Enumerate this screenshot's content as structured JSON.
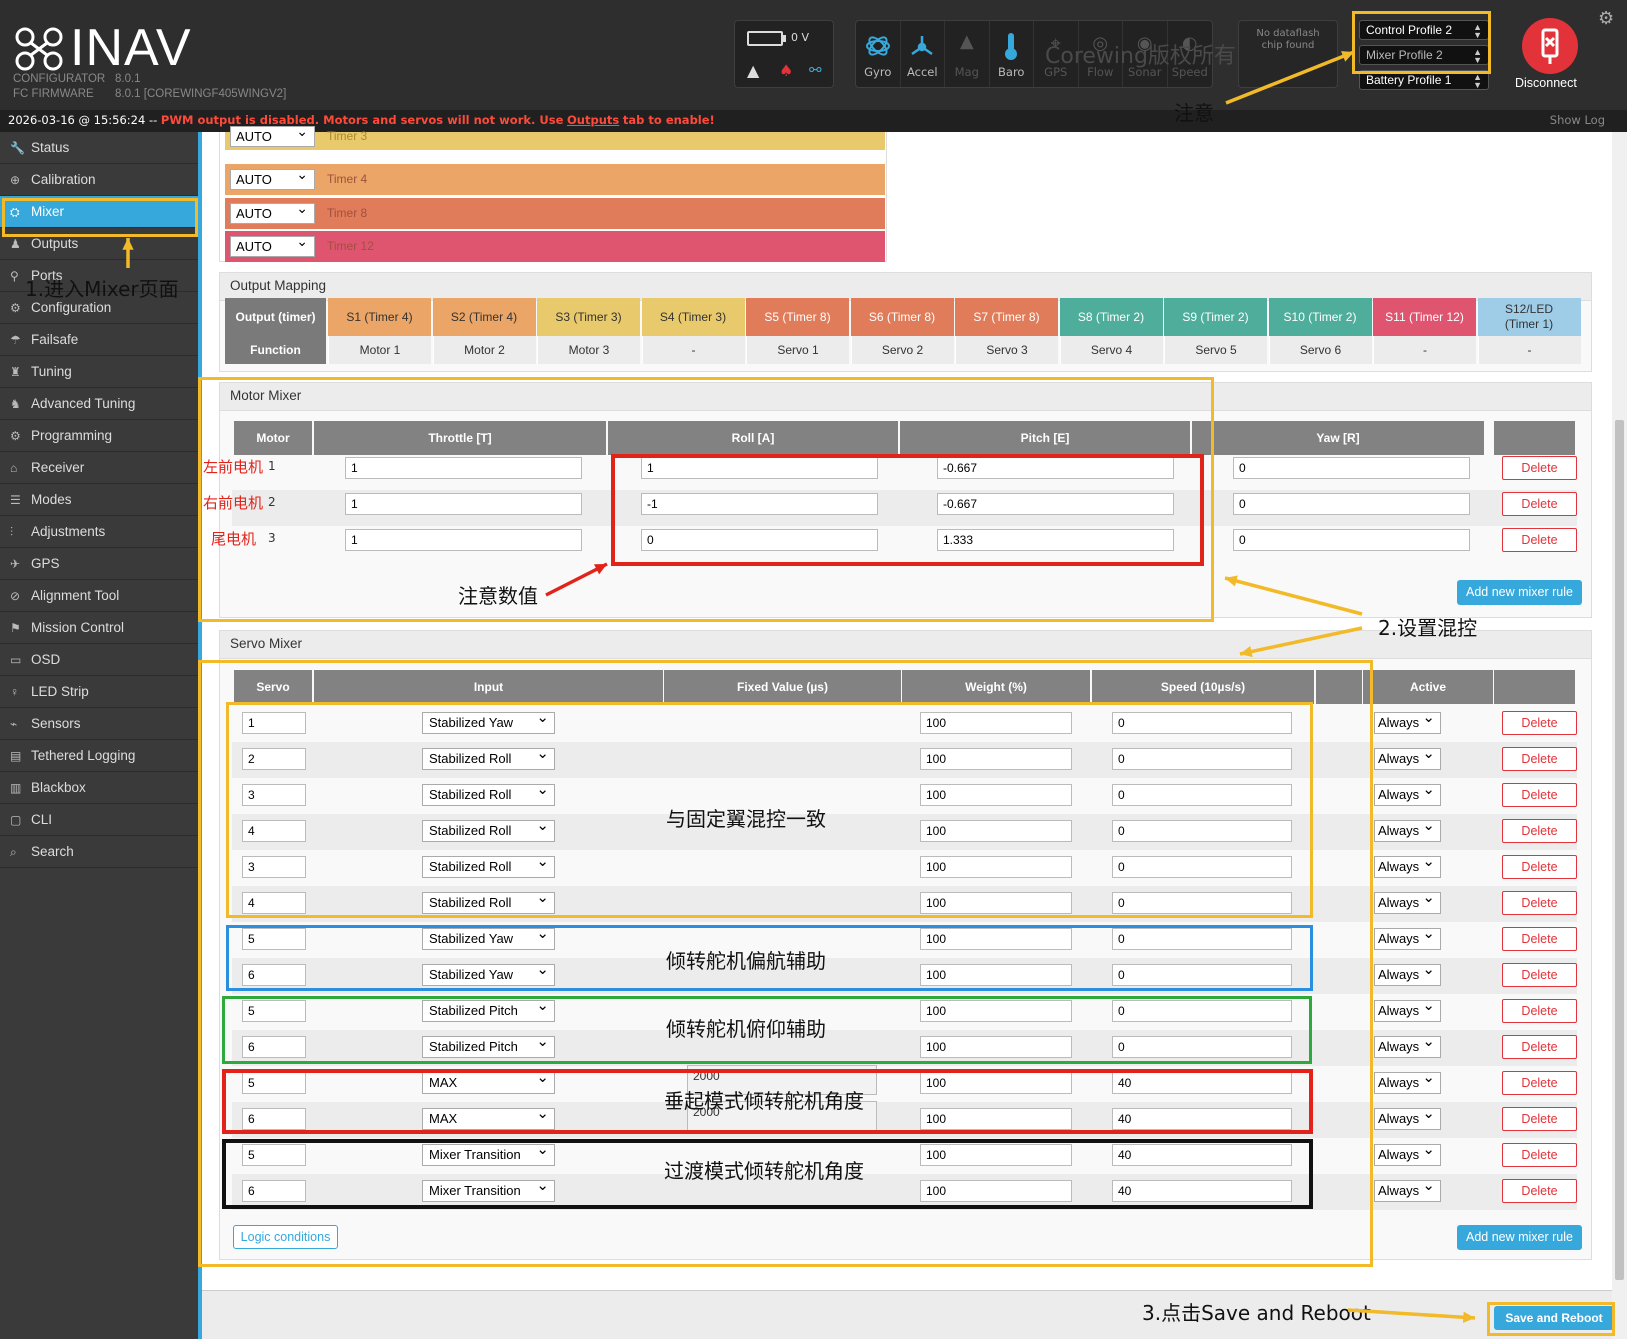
{
  "app": {
    "name": "INAV",
    "configurator_label": "CONFIGURATOR",
    "configurator_version": "8.0.1",
    "firmware_label": "FC FIRMWARE",
    "firmware_version": "8.0.1 [COREWINGF405WINGV2]"
  },
  "battery": {
    "voltage": "0 V"
  },
  "sensors": [
    {
      "label": "Gyro",
      "icon": "gyro-icon",
      "active": true
    },
    {
      "label": "Accel",
      "icon": "accel-icon",
      "active": true
    },
    {
      "label": "Mag",
      "icon": "mag-icon",
      "active": false
    },
    {
      "label": "Baro",
      "icon": "baro-icon",
      "active": true
    },
    {
      "label": "GPS",
      "icon": "gps-icon",
      "active": false
    },
    {
      "label": "Flow",
      "icon": "flow-icon",
      "active": false
    },
    {
      "label": "Sonar",
      "icon": "sonar-icon",
      "active": false
    },
    {
      "label": "Speed",
      "icon": "speed-icon",
      "active": false
    }
  ],
  "dataflash": {
    "line1": "No dataflash",
    "line2": "chip found"
  },
  "profiles": {
    "control": "Control Profile 2",
    "mixer": "Mixer Profile 2",
    "battery": "Battery Profile 1"
  },
  "disconnect_label": "Disconnect",
  "watermark": "Corewing版权所有",
  "statusbar": {
    "timestamp": "2026-03-16 @ 15:56:24 --",
    "warning_pre": "PWM output is disabled. Motors and servos will not work. Use",
    "warning_link": "Outputs",
    "warning_post": "tab to enable!",
    "show_log": "Show Log"
  },
  "sidebar": [
    {
      "label": "Status",
      "icon": "wrench-icon",
      "active": false
    },
    {
      "label": "Calibration",
      "icon": "crosshair-icon",
      "active": false
    },
    {
      "label": "Mixer",
      "icon": "mixer-icon",
      "active": true
    },
    {
      "label": "Outputs",
      "icon": "motor-icon",
      "active": false
    },
    {
      "label": "Ports",
      "icon": "plug-icon",
      "active": false
    },
    {
      "label": "Configuration",
      "icon": "gear-icon",
      "active": false
    },
    {
      "label": "Failsafe",
      "icon": "failsafe-icon",
      "active": false
    },
    {
      "label": "Tuning",
      "icon": "tuning-icon",
      "active": false
    },
    {
      "label": "Advanced Tuning",
      "icon": "advanced-tuning-icon",
      "active": false
    },
    {
      "label": "Programming",
      "icon": "gear-icon",
      "active": false
    },
    {
      "label": "Receiver",
      "icon": "receiver-icon",
      "active": false
    },
    {
      "label": "Modes",
      "icon": "modes-icon",
      "active": false
    },
    {
      "label": "Adjustments",
      "icon": "sliders-icon",
      "active": false
    },
    {
      "label": "GPS",
      "icon": "satellite-icon",
      "active": false
    },
    {
      "label": "Alignment Tool",
      "icon": "compass-icon",
      "active": false
    },
    {
      "label": "Mission Control",
      "icon": "map-pin-icon",
      "active": false
    },
    {
      "label": "OSD",
      "icon": "osd-icon",
      "active": false
    },
    {
      "label": "LED Strip",
      "icon": "led-icon",
      "active": false
    },
    {
      "label": "Sensors",
      "icon": "sensors-icon",
      "active": false
    },
    {
      "label": "Tethered Logging",
      "icon": "logging-icon",
      "active": false
    },
    {
      "label": "Blackbox",
      "icon": "blackbox-icon",
      "active": false
    },
    {
      "label": "CLI",
      "icon": "terminal-icon",
      "active": false
    },
    {
      "label": "Search",
      "icon": "search-icon",
      "active": false
    }
  ],
  "timers": [
    {
      "mode": "AUTO",
      "label": "Timer 3",
      "color": "#e8c96b"
    },
    {
      "mode": "AUTO",
      "label": "Timer 4",
      "color": "#eba566"
    },
    {
      "mode": "AUTO",
      "label": "Timer 8",
      "color": "#e07c5a"
    },
    {
      "mode": "AUTO",
      "label": "Timer 12",
      "color": "#df5570"
    }
  ],
  "output_mapping": {
    "title": "Output Mapping",
    "header_label": "Output (timer)",
    "function_label": "Function",
    "columns": [
      {
        "output": "S1 (Timer 4)",
        "function": "Motor 1",
        "color": "#eba566"
      },
      {
        "output": "S2 (Timer 4)",
        "function": "Motor 2",
        "color": "#eba566"
      },
      {
        "output": "S3 (Timer 3)",
        "function": "Motor 3",
        "color": "#e8c96b"
      },
      {
        "output": "S4 (Timer 3)",
        "function": "-",
        "color": "#e8c96b"
      },
      {
        "output": "S5 (Timer 8)",
        "function": "Servo 1",
        "color": "#e07c5a"
      },
      {
        "output": "S6 (Timer 8)",
        "function": "Servo 2",
        "color": "#e07c5a"
      },
      {
        "output": "S7 (Timer 8)",
        "function": "Servo 3",
        "color": "#e07c5a"
      },
      {
        "output": "S8 (Timer 2)",
        "function": "Servo 4",
        "color": "#4fae9b"
      },
      {
        "output": "S9 (Timer 2)",
        "function": "Servo 5",
        "color": "#4fae9b"
      },
      {
        "output": "S10 (Timer 2)",
        "function": "Servo 6",
        "color": "#4fae9b"
      },
      {
        "output": "S11 (Timer 12)",
        "function": "-",
        "color": "#df5570"
      },
      {
        "output": "S12/LED (Timer 1)",
        "function": "-",
        "color": "#9fcde8"
      }
    ]
  },
  "motor_mixer": {
    "title": "Motor Mixer",
    "headers": [
      "Motor",
      "Throttle [T]",
      "Roll [A]",
      "Pitch [E]",
      "Yaw [R]"
    ],
    "rows": [
      {
        "motor": "1",
        "throttle": "1",
        "roll": "1",
        "pitch": "-0.667",
        "yaw": "0",
        "note": "左前电机"
      },
      {
        "motor": "2",
        "throttle": "1",
        "roll": "-1",
        "pitch": "-0.667",
        "yaw": "0",
        "note": "右前电机"
      },
      {
        "motor": "3",
        "throttle": "1",
        "roll": "0",
        "pitch": "1.333",
        "yaw": "0",
        "note": "尾电机"
      }
    ],
    "delete_label": "Delete",
    "add_label": "Add new mixer rule"
  },
  "servo_mixer": {
    "title": "Servo Mixer",
    "headers": [
      "Servo",
      "Input",
      "Fixed Value (µs)",
      "Weight (%)",
      "Speed (10µs/s)",
      "",
      "Active"
    ],
    "rows": [
      {
        "servo": "1",
        "input": "Stabilized Yaw",
        "fixed": "",
        "weight": "100",
        "speed": "0",
        "active": "Always"
      },
      {
        "servo": "2",
        "input": "Stabilized Roll",
        "fixed": "",
        "weight": "100",
        "speed": "0",
        "active": "Always"
      },
      {
        "servo": "3",
        "input": "Stabilized Roll",
        "fixed": "",
        "weight": "100",
        "speed": "0",
        "active": "Always"
      },
      {
        "servo": "4",
        "input": "Stabilized Roll",
        "fixed": "",
        "weight": "100",
        "speed": "0",
        "active": "Always"
      },
      {
        "servo": "3",
        "input": "Stabilized Roll",
        "fixed": "",
        "weight": "100",
        "speed": "0",
        "active": "Always"
      },
      {
        "servo": "4",
        "input": "Stabilized Roll",
        "fixed": "",
        "weight": "100",
        "speed": "0",
        "active": "Always"
      },
      {
        "servo": "5",
        "input": "Stabilized Yaw",
        "fixed": "",
        "weight": "100",
        "speed": "0",
        "active": "Always"
      },
      {
        "servo": "6",
        "input": "Stabilized Yaw",
        "fixed": "",
        "weight": "100",
        "speed": "0",
        "active": "Always"
      },
      {
        "servo": "5",
        "input": "Stabilized Pitch",
        "fixed": "",
        "weight": "100",
        "speed": "0",
        "active": "Always"
      },
      {
        "servo": "6",
        "input": "Stabilized Pitch",
        "fixed": "",
        "weight": "100",
        "speed": "0",
        "active": "Always"
      },
      {
        "servo": "5",
        "input": "MAX",
        "fixed": "2000",
        "weight": "100",
        "speed": "40",
        "active": "Always"
      },
      {
        "servo": "6",
        "input": "MAX",
        "fixed": "2000",
        "weight": "100",
        "speed": "40",
        "active": "Always"
      },
      {
        "servo": "5",
        "input": "Mixer Transition",
        "fixed": "",
        "weight": "100",
        "speed": "40",
        "active": "Always"
      },
      {
        "servo": "6",
        "input": "Mixer Transition",
        "fixed": "",
        "weight": "100",
        "speed": "40",
        "active": "Always"
      }
    ],
    "delete_label": "Delete",
    "logic_label": "Logic conditions",
    "add_label": "Add new mixer rule"
  },
  "save_label": "Save and Reboot",
  "annotations": {
    "step1": "1.进入Mixer页面",
    "step2": "2.设置混控",
    "step3": "3.点击Save and Reboot",
    "attention": "注意",
    "attention_values": "注意数值",
    "fixed_wing": "与固定翼混控一致",
    "yaw_assist": "倾转舵机偏航辅助",
    "pitch_assist": "倾转舵机俯仰辅助",
    "vtol_angle": "垂起模式倾转舵机角度",
    "transition_angle": "过渡模式倾转舵机角度"
  },
  "colors": {
    "accent": "#37a8db",
    "warning": "#ff4a3a",
    "delete": "#e2333a",
    "annotation_yellow": "#f2b928"
  }
}
